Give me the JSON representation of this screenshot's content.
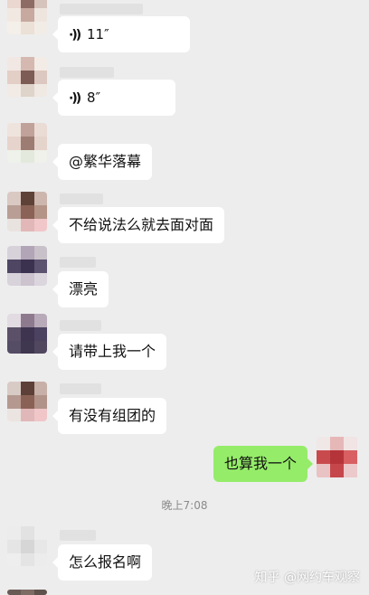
{
  "messages": [
    {
      "type": "voice",
      "text": "11″"
    },
    {
      "type": "voice",
      "text": "8″"
    },
    {
      "type": "text",
      "text": "@繁华落幕"
    },
    {
      "type": "text",
      "text": "不给说法么就去面对面"
    },
    {
      "type": "text",
      "text": "漂亮"
    },
    {
      "type": "text",
      "text": "请带上我一个"
    },
    {
      "type": "text",
      "text": "有没有组团的"
    },
    {
      "type": "text",
      "side": "right",
      "text": "也算我一个"
    },
    {
      "type": "text",
      "text": "怎么报名啊"
    }
  ],
  "timestamp": "晚上7:08",
  "watermark": "知乎 @网约车观察",
  "colors": {
    "background": "#ededed",
    "incoming_bubble": "#ffffff",
    "outgoing_bubble": "#95ec69",
    "timestamp": "#8a8a8a"
  },
  "icons": {
    "voice": "voice-wave-icon"
  }
}
